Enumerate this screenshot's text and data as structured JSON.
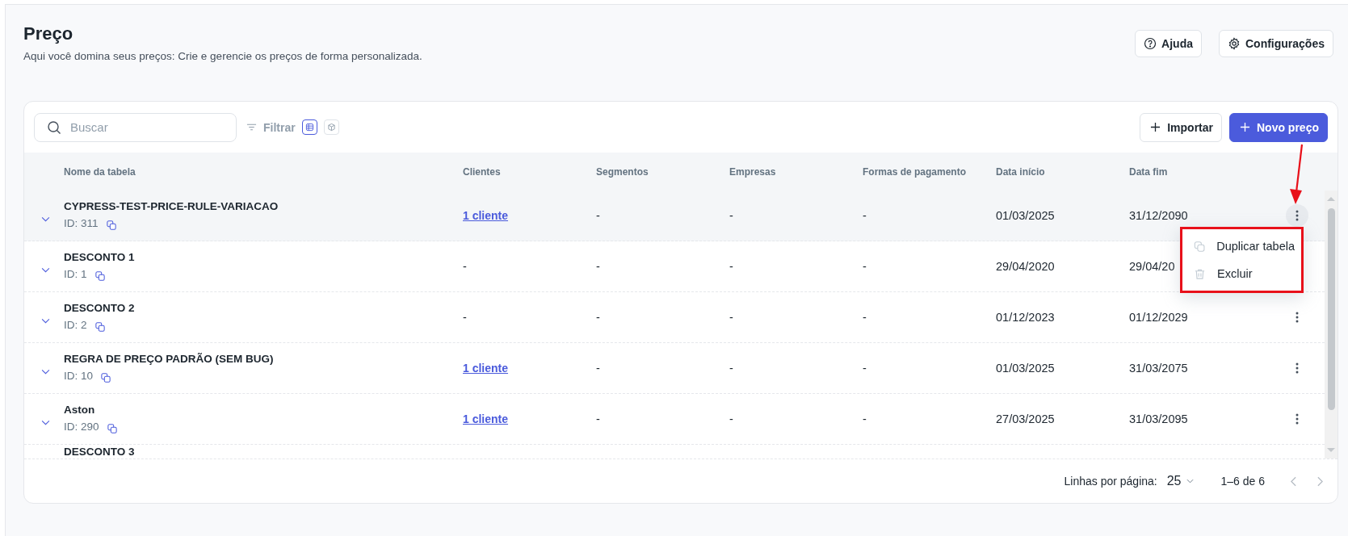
{
  "header": {
    "title": "Preço",
    "subtitle": "Aqui você domina seus preços: Crie e gerencie os preços de forma personalizada.",
    "buttons": [
      {
        "label": "Ajuda",
        "kind": "help"
      },
      {
        "label": "Configurações",
        "kind": "settings"
      }
    ]
  },
  "toolbar": {
    "search": {
      "placeholder": "Buscar"
    },
    "filter": {
      "label": "Filtrar"
    },
    "view_toggles": [
      {
        "kind": "table",
        "selected": true
      },
      {
        "kind": "box",
        "selected": false
      }
    ],
    "actions": [
      {
        "label": "Importar",
        "kind": "secondary"
      },
      {
        "label": "Novo preço",
        "kind": "primary"
      }
    ]
  },
  "table": {
    "columns": [
      "Nome da tabela",
      "Clientes",
      "Segmentos",
      "Empresas",
      "Formas de pagamento",
      "Data início",
      "Data fim"
    ],
    "rows": [
      {
        "name": "CYPRESS-TEST-PRICE-RULE-VARIACAO",
        "id": "ID: 311",
        "selected": true,
        "cells": [
          {
            "text": "1 cliente",
            "kind": "link"
          },
          {
            "text": "-",
            "kind": "text"
          },
          {
            "text": "-",
            "kind": "text"
          },
          {
            "text": "-",
            "kind": "text"
          },
          {
            "text": "01/03/2025",
            "kind": "text"
          },
          {
            "text": "31/12/2090",
            "kind": "text"
          }
        ]
      },
      {
        "name": "DESCONTO 1",
        "id": "ID: 1",
        "selected": false,
        "cells": [
          {
            "text": "-",
            "kind": "text"
          },
          {
            "text": "-",
            "kind": "text"
          },
          {
            "text": "-",
            "kind": "text"
          },
          {
            "text": "-",
            "kind": "text"
          },
          {
            "text": "29/04/2020",
            "kind": "text"
          },
          {
            "text": "29/04/20",
            "kind": "text"
          }
        ]
      },
      {
        "name": "DESCONTO 2",
        "id": "ID: 2",
        "selected": false,
        "cells": [
          {
            "text": "-",
            "kind": "text"
          },
          {
            "text": "-",
            "kind": "text"
          },
          {
            "text": "-",
            "kind": "text"
          },
          {
            "text": "-",
            "kind": "text"
          },
          {
            "text": "01/12/2023",
            "kind": "text"
          },
          {
            "text": "01/12/2029",
            "kind": "text"
          }
        ]
      },
      {
        "name": "REGRA DE PREÇO PADRÃO (SEM BUG)",
        "id": "ID: 10",
        "selected": false,
        "cells": [
          {
            "text": "1 cliente",
            "kind": "link"
          },
          {
            "text": "-",
            "kind": "text"
          },
          {
            "text": "-",
            "kind": "text"
          },
          {
            "text": "-",
            "kind": "text"
          },
          {
            "text": "01/03/2025",
            "kind": "text"
          },
          {
            "text": "31/03/2075",
            "kind": "text"
          }
        ]
      },
      {
        "name": "Aston",
        "id": "ID: 290",
        "selected": false,
        "cells": [
          {
            "text": "1 cliente",
            "kind": "link"
          },
          {
            "text": "-",
            "kind": "text"
          },
          {
            "text": "-",
            "kind": "text"
          },
          {
            "text": "-",
            "kind": "text"
          },
          {
            "text": "27/03/2025",
            "kind": "text"
          },
          {
            "text": "31/03/2095",
            "kind": "text"
          }
        ]
      },
      {
        "name": "DESCONTO 3"
      }
    ]
  },
  "menu": {
    "items": [
      {
        "label": "Duplicar tabela",
        "kind": "duplicate"
      },
      {
        "label": "Excluir",
        "kind": "delete"
      }
    ]
  },
  "footer": {
    "rows_label": "Linhas por página:",
    "rows_value": "25",
    "range": "1–6 de 6"
  }
}
